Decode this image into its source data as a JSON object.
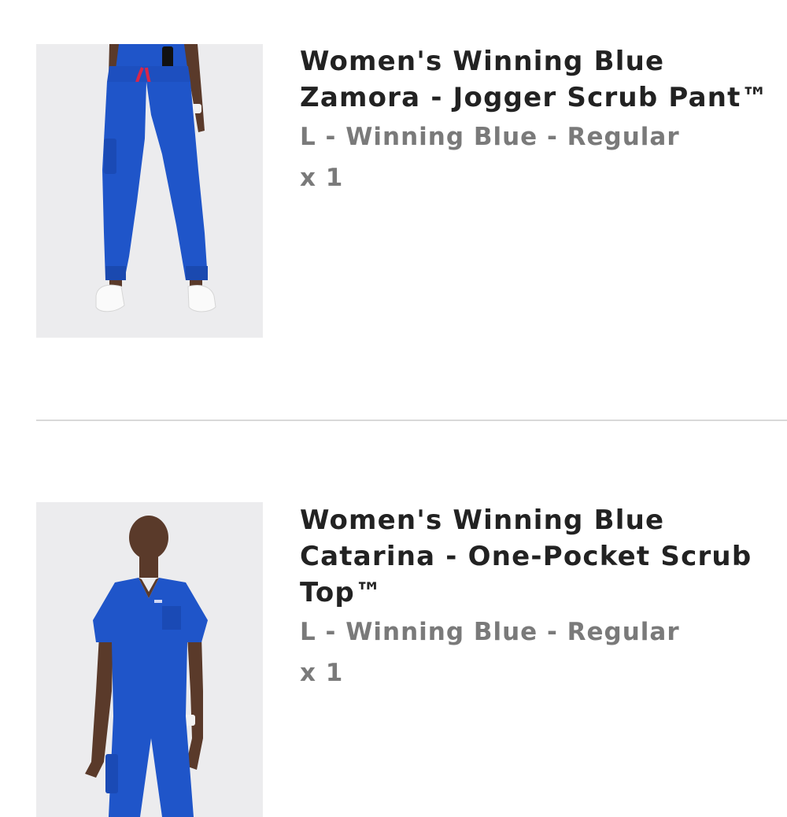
{
  "cart": {
    "items": [
      {
        "image_icon": "jogger-scrub-pant-image",
        "title_line1": "Women's Winning Blue",
        "title_line2": "Zamora - Jogger Scrub Pant™",
        "title_line3": "",
        "variant": "L - Winning Blue - Regular",
        "quantity": "x 1"
      },
      {
        "image_icon": "scrub-top-image",
        "title_line1": "Women's Winning Blue",
        "title_line2": "Catarina - One-Pocket Scrub",
        "title_line3": "Top™",
        "variant": "L - Winning Blue - Regular",
        "quantity": "x 1"
      }
    ]
  },
  "colors": {
    "product_blue": "#1f55c9",
    "title_text": "#222222",
    "meta_text": "#7a7a7a"
  }
}
